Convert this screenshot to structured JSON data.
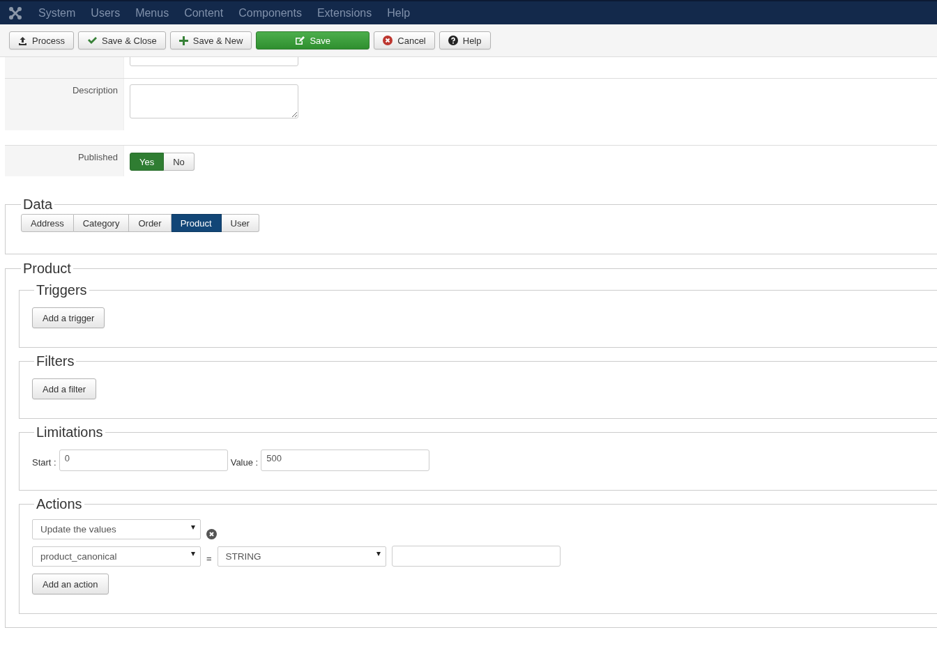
{
  "menu": {
    "items": [
      "System",
      "Users",
      "Menus",
      "Content",
      "Components",
      "Extensions",
      "Help"
    ]
  },
  "toolbar": {
    "buttons": [
      {
        "label": "Process",
        "kind": "default"
      },
      {
        "label": "Save & Close",
        "kind": "default"
      },
      {
        "label": "Save & New",
        "kind": "default"
      },
      {
        "label": "Save",
        "kind": "primary"
      },
      {
        "label": "Cancel",
        "kind": "default"
      },
      {
        "label": "Help",
        "kind": "default"
      }
    ]
  },
  "form_rows": [
    {
      "kind": "cut"
    },
    {
      "label": "Description",
      "kind": "textarea"
    },
    {
      "label": "Published",
      "kind": "toggle",
      "options": [
        {
          "label": "Yes",
          "selected": true
        },
        {
          "label": "No",
          "selected": false
        }
      ]
    }
  ],
  "data": {
    "legend": "Data",
    "tabs": [
      {
        "label": "Address",
        "selected": false
      },
      {
        "label": "Category",
        "selected": false
      },
      {
        "label": "Order",
        "selected": false
      },
      {
        "label": "Product",
        "selected": true
      },
      {
        "label": "User",
        "selected": false
      }
    ]
  },
  "product": {
    "legend": "Product",
    "triggers": {
      "legend": "Triggers",
      "button": "Add a trigger"
    },
    "filters": {
      "legend": "Filters",
      "button": "Add a filter"
    },
    "limitations": {
      "legend": "Limitations",
      "fields": [
        {
          "label": "Start :",
          "value": "0"
        },
        {
          "label": "Value :",
          "value": "500"
        }
      ]
    },
    "actions": {
      "legend": "Actions",
      "action": "Update the values",
      "field": "product_canonical",
      "operator": "=",
      "type": "STRING",
      "button": "Add an action"
    }
  }
}
